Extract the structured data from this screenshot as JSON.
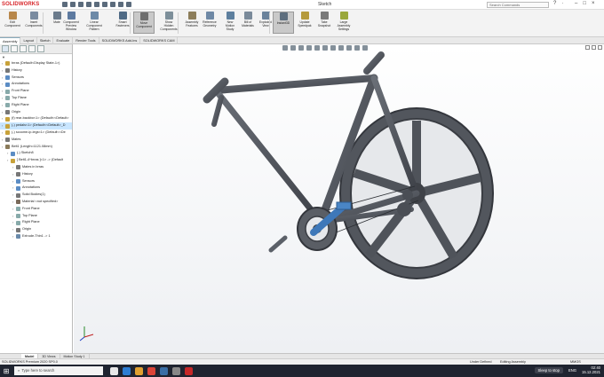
{
  "app": {
    "title": "Sketch",
    "logo": "SOLIDWORKS",
    "search_placeholder": "Search Commands"
  },
  "ribbon": [
    {
      "label": "Edit\nComponent",
      "color": "#b8874a"
    },
    {
      "label": "Insert\nComponents",
      "color": "#7a8ba0"
    },
    {
      "label": "Mate",
      "color": "#6b7b8c"
    },
    {
      "label": "Component\nPreview\nWindow",
      "color": "#5d7aa0"
    },
    {
      "label": "Linear Component\nPattern",
      "color": "#6d8aa8"
    },
    {
      "label": "Smart\nFasteners",
      "color": "#4f6a85"
    },
    {
      "label": "Move\nComponent",
      "color": "#6e6e6e",
      "active": true
    },
    {
      "label": "Show\nHidden\nComponents",
      "color": "#7d8f9a"
    },
    {
      "label": "Assembly\nFeatures",
      "color": "#8c7d5a"
    },
    {
      "label": "Reference\nGeometry",
      "color": "#6e88a5"
    },
    {
      "label": "New\nMotion\nStudy",
      "color": "#5d7f9e"
    },
    {
      "label": "Bill of\nMaterials",
      "color": "#7a8a9a"
    },
    {
      "label": "Exploded\nView",
      "color": "#6a829b"
    },
    {
      "label": "Instant3D",
      "color": "#5e6e7e",
      "active": true
    },
    {
      "label": "Update\nSpeedpak",
      "color": "#b59a3c"
    },
    {
      "label": "Take\nSnapshot",
      "color": "#7a7a7a"
    },
    {
      "label": "Large\nAssembly\nSettings",
      "color": "#9aa83c"
    }
  ],
  "tabs": [
    "Assembly",
    "Layout",
    "Sketch",
    "Evaluate",
    "Render Tools",
    "SOLIDWORKS Add-Ins",
    "SOLIDWORKS CAM"
  ],
  "active_tab": "Assembly",
  "tree": [
    {
      "label": "brras  (Default<Display State-1>)",
      "indent": 0,
      "color": "#c8a23a"
    },
    {
      "label": "History",
      "indent": 0,
      "color": "#777"
    },
    {
      "label": "Sensors",
      "indent": 0,
      "color": "#5b8cc4"
    },
    {
      "label": "Annotations",
      "indent": 0,
      "color": "#5b8cc4"
    },
    {
      "label": "Front Plane",
      "indent": 0,
      "color": "#8aa"
    },
    {
      "label": "Top Plane",
      "indent": 0,
      "color": "#8aa"
    },
    {
      "label": "Right Plane",
      "indent": 0,
      "color": "#8aa"
    },
    {
      "label": "Origin",
      "indent": 0,
      "color": "#777"
    },
    {
      "label": "(f) rear-backbo<1> (Default<<Default>",
      "indent": 0,
      "color": "#c8a23a"
    },
    {
      "label": "(-) pedals<1> (Default<<Default>_D",
      "indent": 0,
      "color": "#c8a23a",
      "selected": true
    },
    {
      "label": "(-) scoome-ip-legs<1> (Default<<De",
      "indent": 0,
      "color": "#c8a23a"
    },
    {
      "label": "Mates",
      "indent": 0,
      "color": "#777"
    },
    {
      "label": "Belt1 (Length=1121.08mm)",
      "indent": 0,
      "color": "#8a7a5a"
    },
    {
      "label": "(-) Sketch8",
      "indent": 1,
      "color": "#5b8cc4"
    },
    {
      "label": "[ Belt1-4^brras ]<1> -> (Default",
      "indent": 1,
      "color": "#c8a23a"
    },
    {
      "label": "Mates in brras",
      "indent": 2,
      "color": "#777"
    },
    {
      "label": "History",
      "indent": 2,
      "color": "#777"
    },
    {
      "label": "Sensors",
      "indent": 2,
      "color": "#5b8cc4"
    },
    {
      "label": "Annotations",
      "indent": 2,
      "color": "#5b8cc4"
    },
    {
      "label": "Solid Bodies(1)",
      "indent": 2,
      "color": "#777"
    },
    {
      "label": "Material <not specified>",
      "indent": 2,
      "color": "#7a6a5a"
    },
    {
      "label": "Front Plane",
      "indent": 2,
      "color": "#8aa"
    },
    {
      "label": "Top Plane",
      "indent": 2,
      "color": "#8aa"
    },
    {
      "label": "Right Plane",
      "indent": 2,
      "color": "#8aa"
    },
    {
      "label": "Origin",
      "indent": 2,
      "color": "#777"
    },
    {
      "label": "Extrude-Thin1 -> 1",
      "indent": 2,
      "color": "#6a8aaa"
    }
  ],
  "bottom_tabs": [
    "Model",
    "3D Views",
    "Motion Study 1"
  ],
  "active_bottom_tab": "Model",
  "status": {
    "left": "SOLIDWORKS Premium 2020 SP0.0",
    "under_defined": "Under Defined",
    "editing": "Editing Assembly",
    "units": "MMGS"
  },
  "taskbar": {
    "search": "Type here to search",
    "sleep": "Sleep to stop",
    "lang": "ENG",
    "time": "02:40",
    "date": "15.12.2021",
    "apps": [
      "#e8e8e8",
      "#2d7dd2",
      "#e0a030",
      "#db4437",
      "#3a6ea5",
      "#888",
      "#c62828"
    ]
  },
  "colors": {
    "frame": "#4f535a",
    "highlight": "#3e78b9"
  }
}
